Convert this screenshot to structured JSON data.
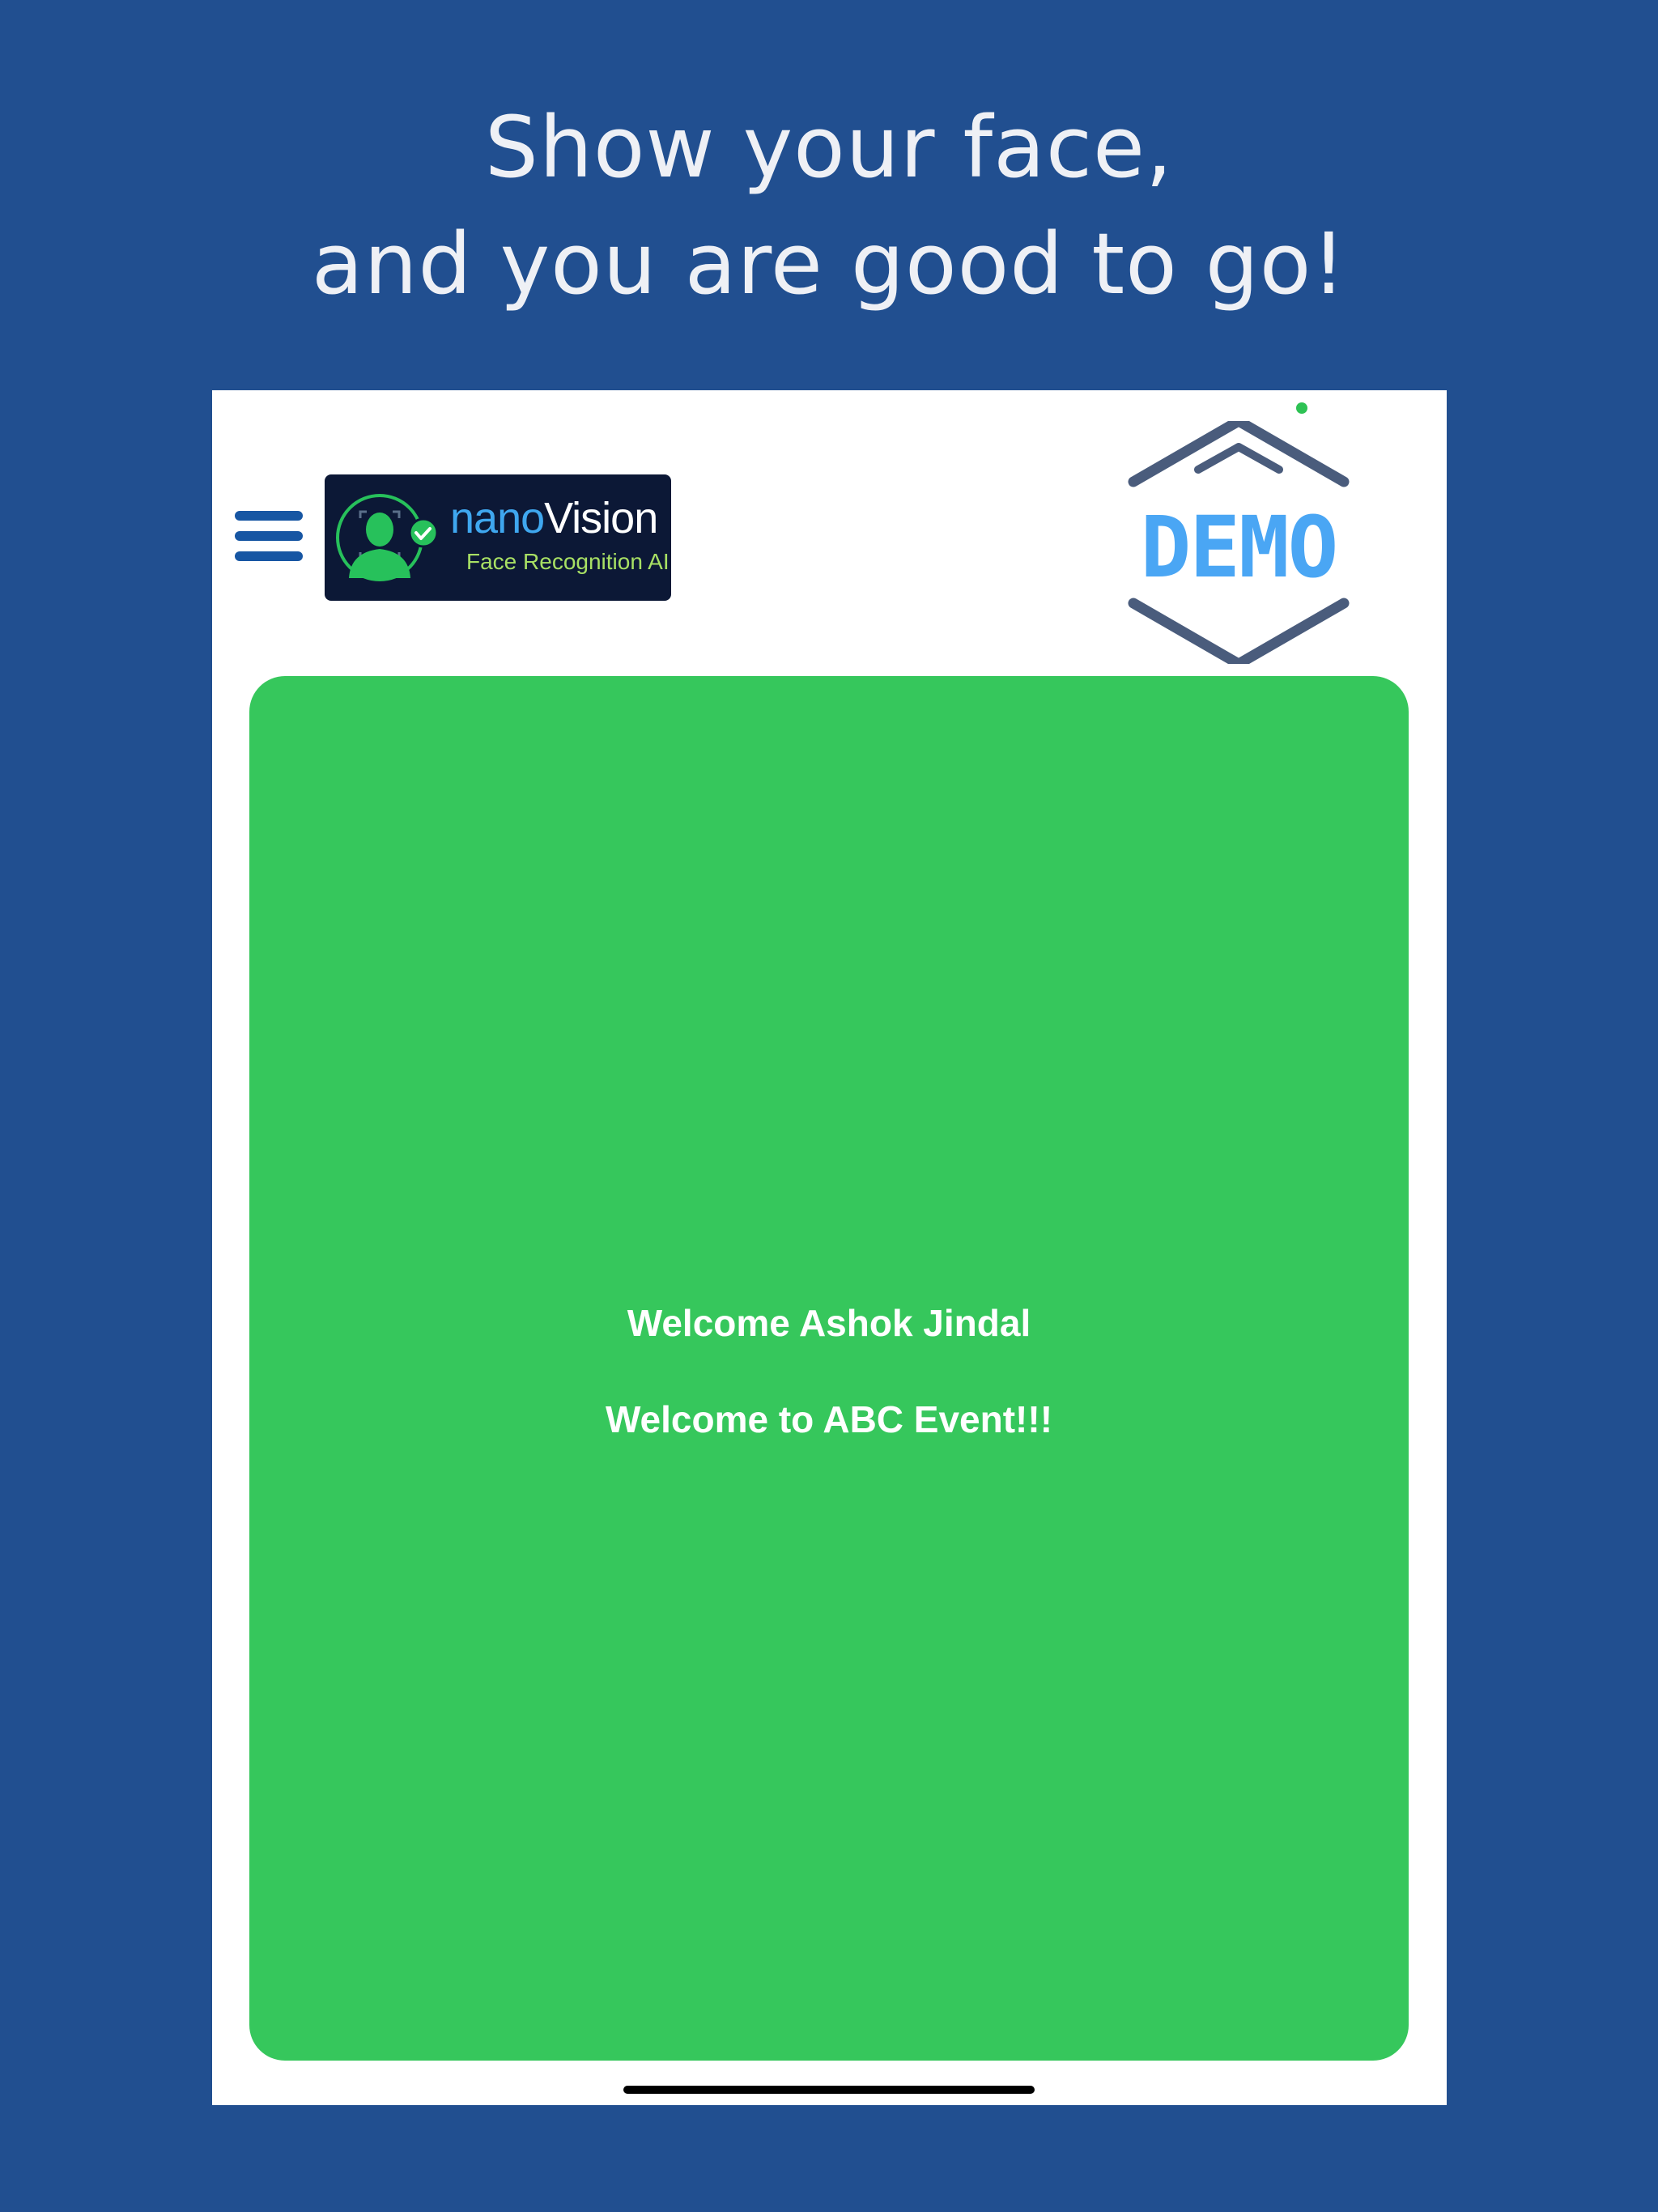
{
  "headline": {
    "line1": "Show your face,",
    "line2": "and you are good to go!"
  },
  "app": {
    "logo": {
      "wordmark_nano": "nano",
      "wordmark_vision": "Vision",
      "tagline": "Face Recognition AI",
      "colors": {
        "background": "#0c1836",
        "accent": "#3fa7ef",
        "tagline": "#a8e064",
        "icon": "#27c15b"
      }
    },
    "demo_badge": {
      "text": "DEMO",
      "colors": {
        "text": "#4aa6f4",
        "outline": "#4a5c7c"
      }
    },
    "menu_icon": "hamburger-menu-icon",
    "status_panel": {
      "welcome_name": "Welcome Ashok Jindal",
      "welcome_event": "Welcome to ABC Event!!!",
      "color": "#36c75c"
    }
  },
  "colors": {
    "page_background": "#214f90",
    "device_screen": "#ffffff",
    "camera_indicator": "#2ec254"
  }
}
